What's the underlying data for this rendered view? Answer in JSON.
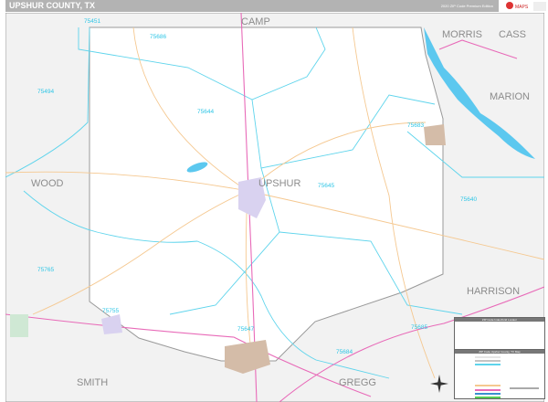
{
  "header": {
    "title": "UPSHUR COUNTY, TX",
    "edition": "2020 ZIP Code Premium Edition"
  },
  "logo": {
    "text": "Market MAPS"
  },
  "counties": [
    {
      "name": "CAMP"
    },
    {
      "name": "MORRIS"
    },
    {
      "name": "CASS"
    },
    {
      "name": "MARION"
    },
    {
      "name": "WOOD"
    },
    {
      "name": "UPSHUR"
    },
    {
      "name": "HARRISON"
    },
    {
      "name": "SMITH"
    },
    {
      "name": "GREGG"
    }
  ],
  "zip_codes": [
    "75451",
    "75686",
    "75494",
    "75644",
    "75683",
    "75645",
    "75640",
    "75765",
    "75755",
    "75647",
    "75684",
    "75685"
  ],
  "legend": {
    "index_title": "ZIP Code Index/Grid Locator",
    "map_title": "ZIP Code Upshur County, TX Map"
  },
  "colors": {
    "header": "#b3b3b3",
    "zip": "#2fc6e6",
    "water": "#5cc8ef",
    "highway": "#e86ab8",
    "road": "#f5c890",
    "city": "#d9d2f0"
  }
}
